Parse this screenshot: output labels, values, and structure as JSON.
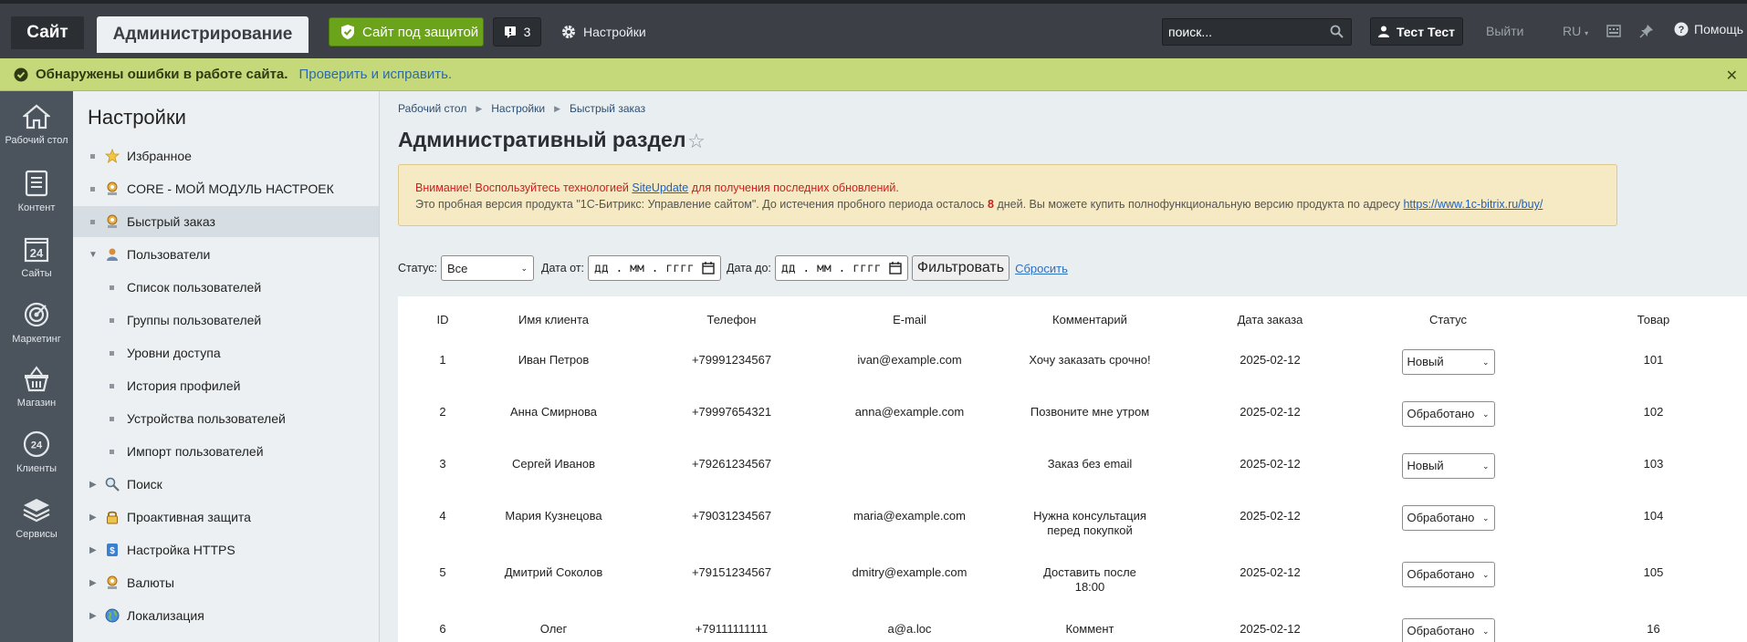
{
  "topbar": {
    "tab_site": "Сайт",
    "tab_admin": "Администрирование",
    "protect_button": "Сайт под защитой",
    "notify_count": "3",
    "settings_link": "Настройки",
    "search_placeholder": "поиск...",
    "user_name": "Тест Тест",
    "logout": "Выйти",
    "lang": "RU",
    "help": "Помощь"
  },
  "errorbar": {
    "text": "Обнаружены ошибки в работе сайта.",
    "link": "Проверить и исправить."
  },
  "leftmenu": [
    {
      "label": "Рабочий стол",
      "icon": "home-icon"
    },
    {
      "label": "Контент",
      "icon": "document-icon"
    },
    {
      "label": "Сайты",
      "icon": "calendar-24-icon"
    },
    {
      "label": "Маркетинг",
      "icon": "target-icon"
    },
    {
      "label": "Магазин",
      "icon": "basket-icon"
    },
    {
      "label": "Клиенты",
      "icon": "crm-24-icon"
    },
    {
      "label": "Сервисы",
      "icon": "layers-icon"
    }
  ],
  "settings": {
    "title": "Настройки",
    "items": [
      {
        "label": "Избранное"
      },
      {
        "label": "CORE - МОЙ МОДУЛЬ НАСТРОЕК"
      },
      {
        "label": "Быстрый заказ"
      },
      {
        "label": "Пользователи"
      },
      {
        "label": "Список пользователей"
      },
      {
        "label": "Группы пользователей"
      },
      {
        "label": "Уровни доступа"
      },
      {
        "label": "История профилей"
      },
      {
        "label": "Устройства пользователей"
      },
      {
        "label": "Импорт пользователей"
      },
      {
        "label": "Поиск"
      },
      {
        "label": "Проактивная защита"
      },
      {
        "label": "Настройка HTTPS"
      },
      {
        "label": "Валюты"
      },
      {
        "label": "Локализация"
      }
    ]
  },
  "breadcrumb": [
    "Рабочий стол",
    "Настройки",
    "Быстрый заказ"
  ],
  "page_title": "Административный раздел",
  "notice": {
    "line1_prefix": "Внимание! Воспользуйтесь технологией ",
    "line1_link": "SiteUpdate",
    "line1_suffix": " для получения последних обновлений.",
    "line2_prefix": "Это пробная версия продукта \"1С-Битрикс: Управление сайтом\". До истечения пробного периода осталось ",
    "line2_days": "8",
    "line2_mid": " дней. Вы можете купить полнофункциональную версию продукта по адресу ",
    "line2_link": "https://www.1c-bitrix.ru/buy/"
  },
  "filter": {
    "status_label": "Статус:",
    "status_value": "Все",
    "date_from_label": "Дата от:",
    "date_from_value": "дд . мм . гггг",
    "date_to_label": "Дата до:",
    "date_to_value": "дд . мм . гггг",
    "filter_button": "Фильтровать",
    "reset_link": "Сбросить"
  },
  "table": {
    "headers": [
      "ID",
      "Имя клиента",
      "Телефон",
      "E-mail",
      "Комментарий",
      "Дата заказа",
      "Статус",
      "Товар"
    ],
    "rows": [
      {
        "id": "1",
        "name": "Иван Петров",
        "phone": "+79991234567",
        "email": "ivan@example.com",
        "comment": "Хочу заказать срочно!",
        "date": "2025-02-12",
        "status": "Новый",
        "product": "101"
      },
      {
        "id": "2",
        "name": "Анна Смирнова",
        "phone": "+79997654321",
        "email": "anna@example.com",
        "comment": "Позвоните мне утром",
        "date": "2025-02-12",
        "status": "Обработано",
        "product": "102"
      },
      {
        "id": "3",
        "name": "Сергей Иванов",
        "phone": "+79261234567",
        "email": "",
        "comment": "Заказ без email",
        "date": "2025-02-12",
        "status": "Новый",
        "product": "103"
      },
      {
        "id": "4",
        "name": "Мария Кузнецова",
        "phone": "+79031234567",
        "email": "maria@example.com",
        "comment": "Нужна консультация перед покупкой",
        "date": "2025-02-12",
        "status": "Обработано",
        "product": "104"
      },
      {
        "id": "5",
        "name": "Дмитрий Соколов",
        "phone": "+79151234567",
        "email": "dmitry@example.com",
        "comment": "Доставить после 18:00",
        "date": "2025-02-12",
        "status": "Обработано",
        "product": "105"
      },
      {
        "id": "6",
        "name": "Олег",
        "phone": "+79111111111",
        "email": "a@a.loc",
        "comment": "Коммент",
        "date": "2025-02-12",
        "status": "Обработано",
        "product": "16"
      }
    ]
  },
  "colors": {
    "topbar": "#3c4046",
    "errorbar": "#c5d97a",
    "protect_green": "#6ba31b",
    "notice_bg": "#f5eac3",
    "notice_red": "#cc1f1f"
  }
}
